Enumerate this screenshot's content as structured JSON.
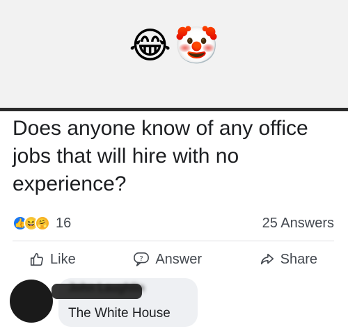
{
  "header": {
    "emojis": [
      {
        "icon": "tears-of-joy-icon",
        "glyph": "😂"
      },
      {
        "icon": "clown-face-icon",
        "glyph": "🤡"
      }
    ]
  },
  "post": {
    "question": "Does anyone know of any office jobs that will hire with no experience?",
    "reaction_count": "16",
    "answers_count": "25 Answers",
    "reactions": [
      "like-reaction-icon",
      "haha-reaction-icon",
      "care-reaction-icon"
    ]
  },
  "actions": {
    "like_label": "Like",
    "answer_label": "Answer",
    "share_label": "Share"
  },
  "comment": {
    "author": "John Laughlin",
    "text": "The White House"
  },
  "colors": {
    "like_blue": "#1877f2",
    "text_primary": "#1c1e21",
    "text_secondary": "#444950",
    "bubble_bg": "#eef0f3"
  }
}
